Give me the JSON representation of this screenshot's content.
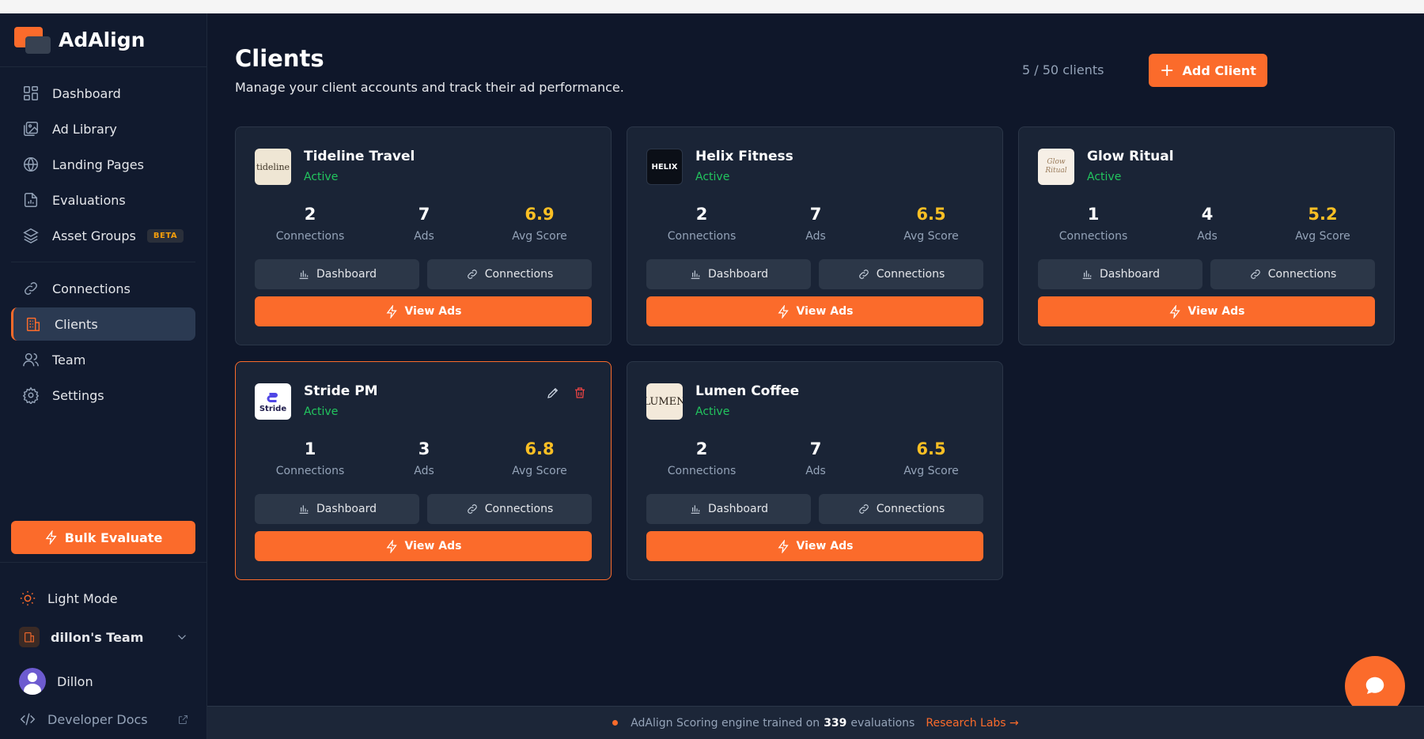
{
  "app": {
    "name": "AdAlign"
  },
  "sidebar": {
    "items": [
      {
        "label": "Dashboard",
        "icon": "grid-icon"
      },
      {
        "label": "Ad Library",
        "icon": "image-stack-icon"
      },
      {
        "label": "Landing Pages",
        "icon": "globe-icon"
      },
      {
        "label": "Evaluations",
        "icon": "document-chart-icon"
      },
      {
        "label": "Asset Groups",
        "icon": "layers-icon",
        "badge": "BETA"
      },
      {
        "label": "Connections",
        "icon": "link-icon"
      },
      {
        "label": "Clients",
        "icon": "building-icon",
        "active": true
      },
      {
        "label": "Team",
        "icon": "users-icon"
      },
      {
        "label": "Settings",
        "icon": "gear-icon"
      }
    ],
    "bulk_label": "Bulk Evaluate",
    "light_mode_label": "Light Mode",
    "team_label": "dillon's Team",
    "user_name": "Dillon",
    "docs_label": "Developer Docs"
  },
  "header": {
    "title": "Clients",
    "subtitle": "Manage your client accounts and track their ad performance.",
    "count": "5 / 50 clients",
    "add_label": "Add Client"
  },
  "cards": [
    {
      "name": "Tideline Travel",
      "status": "Active",
      "connections": "2",
      "ads": "7",
      "score": "6.9",
      "logo_text": "tideline"
    },
    {
      "name": "Helix Fitness",
      "status": "Active",
      "connections": "2",
      "ads": "7",
      "score": "6.5",
      "logo_text": "HELIX"
    },
    {
      "name": "Glow Ritual",
      "status": "Active",
      "connections": "1",
      "ads": "4",
      "score": "5.2",
      "logo_text": "Glow Ritual"
    },
    {
      "name": "Stride PM",
      "status": "Active",
      "connections": "1",
      "ads": "3",
      "score": "6.8",
      "logo_text": "Stride"
    },
    {
      "name": "Lumen Coffee",
      "status": "Active",
      "connections": "2",
      "ads": "7",
      "score": "6.5",
      "logo_text": "LUMEN"
    }
  ],
  "card_labels": {
    "connections": "Connections",
    "ads": "Ads",
    "score": "Avg Score",
    "dashboard_btn": "Dashboard",
    "connections_btn": "Connections",
    "view_btn": "View Ads"
  },
  "footer": {
    "text_before": "AdAlign Scoring engine trained on",
    "count": "339",
    "text_after": "evaluations",
    "link": "Research Labs →"
  },
  "colors": {
    "accent": "#fb6b2b",
    "success": "#22c55e",
    "score": "#fbbf24",
    "bg": "#0f172a",
    "card": "#1a2436"
  }
}
